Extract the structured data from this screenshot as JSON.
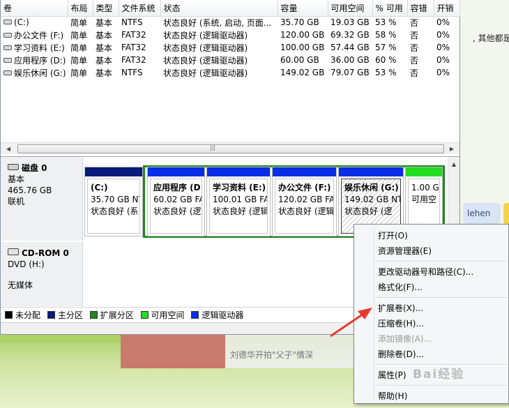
{
  "columns": [
    "卷",
    "布局",
    "类型",
    "文件系统",
    "状态",
    "容量",
    "可用空间",
    "% 可用",
    "容错",
    "开销"
  ],
  "volumes": [
    {
      "name": "(C:)",
      "layout": "简单",
      "type": "基本",
      "fs": "NTFS",
      "status": "状态良好 (系统, 启动, 页面...",
      "capacity": "35.70 GB",
      "free": "19.03 GB",
      "pct": "53 %",
      "ft": "否",
      "overhead": "0%"
    },
    {
      "name": "办公文件 (F:)",
      "layout": "简单",
      "type": "基本",
      "fs": "FAT32",
      "status": "状态良好 (逻辑驱动器)",
      "capacity": "120.00 GB",
      "free": "69.32 GB",
      "pct": "58 %",
      "ft": "否",
      "overhead": "0%"
    },
    {
      "name": "学习资料 (E:)",
      "layout": "简单",
      "type": "基本",
      "fs": "FAT32",
      "status": "状态良好 (逻辑驱动器)",
      "capacity": "100.00 GB",
      "free": "57.44 GB",
      "pct": "57 %",
      "ft": "否",
      "overhead": "0%"
    },
    {
      "name": "应用程序 (D:)",
      "layout": "简单",
      "type": "基本",
      "fs": "FAT32",
      "status": "状态良好 (逻辑驱动器)",
      "capacity": "60.00 GB",
      "free": "36.00 GB",
      "pct": "60 %",
      "ft": "否",
      "overhead": "0%"
    },
    {
      "name": "娱乐休闲 (G:)",
      "layout": "简单",
      "type": "基本",
      "fs": "NTFS",
      "status": "状态良好 (逻辑驱动器)",
      "capacity": "149.02 GB",
      "free": "79.07 GB",
      "pct": "53 %",
      "ft": "否",
      "overhead": "0%"
    }
  ],
  "disk0": {
    "title": "磁盘 0",
    "type": "基本",
    "size": "465.76 GB",
    "state": "联机"
  },
  "partitions": [
    {
      "name": "(C:)",
      "size": "35.70 GB NT",
      "status": "状态良好 (系",
      "bar_color": "#0a1a7a"
    },
    {
      "name": "应用程序 (D",
      "size": "60.02 GB FA",
      "status": "状态良好 (逻",
      "bar_color": "#0a2ee6"
    },
    {
      "name": "学习资料 (E:)",
      "size": "100.01 GB FA",
      "status": "状态良好 (逻辑",
      "bar_color": "#0a2ee6"
    },
    {
      "name": "办公文件 (F:)",
      "size": "120.02 GB FA",
      "status": "状态良好 (逻辑",
      "bar_color": "#0a2ee6"
    },
    {
      "name": "娱乐休闲 (G:)",
      "size": "149.02 GB NT",
      "status": "状态良好 (逻",
      "bar_color": "#0a2ee6"
    },
    {
      "name": "",
      "size": "1.00 GB",
      "status": "可用空",
      "bar_color": "#22dd22"
    }
  ],
  "cdrom": {
    "title": "CD-ROM 0",
    "type": "DVD (H:)",
    "media": "无媒体"
  },
  "legend": [
    {
      "label": "未分配",
      "color": "#000000"
    },
    {
      "label": "主分区",
      "color": "#0a1a7a"
    },
    {
      "label": "扩展分区",
      "color": "#1e8a1e"
    },
    {
      "label": "可用空间",
      "color": "#22dd22"
    },
    {
      "label": "逻辑驱动器",
      "color": "#0a2ee6"
    }
  ],
  "context_menu": [
    {
      "label": "打开(O)",
      "enabled": true
    },
    {
      "label": "资源管理器(E)",
      "enabled": true
    },
    {
      "label": "更改驱动器号和路径(C)...",
      "enabled": true
    },
    {
      "label": "格式化(F)...",
      "enabled": true
    },
    {
      "label": "扩展卷(X)...",
      "enabled": true
    },
    {
      "label": "压缩卷(H)...",
      "enabled": true
    },
    {
      "label": "添加镜像(A)...",
      "enabled": false
    },
    {
      "label": "删除卷(D)...",
      "enabled": true
    },
    {
      "label": "属性(P)",
      "enabled": true
    },
    {
      "label": "帮助(H)",
      "enabled": true
    }
  ],
  "desktop": {
    "chat_text": ", 其他都是全",
    "chat_bubble": "lehen",
    "video_caption": "刘德华开拍\"父子\"情深",
    "watermark": "Bai经验"
  },
  "colors": {
    "arrow": "#e83a2e",
    "extended_frame": "#1e8a1e",
    "header_bg": "#f1f2f4"
  }
}
